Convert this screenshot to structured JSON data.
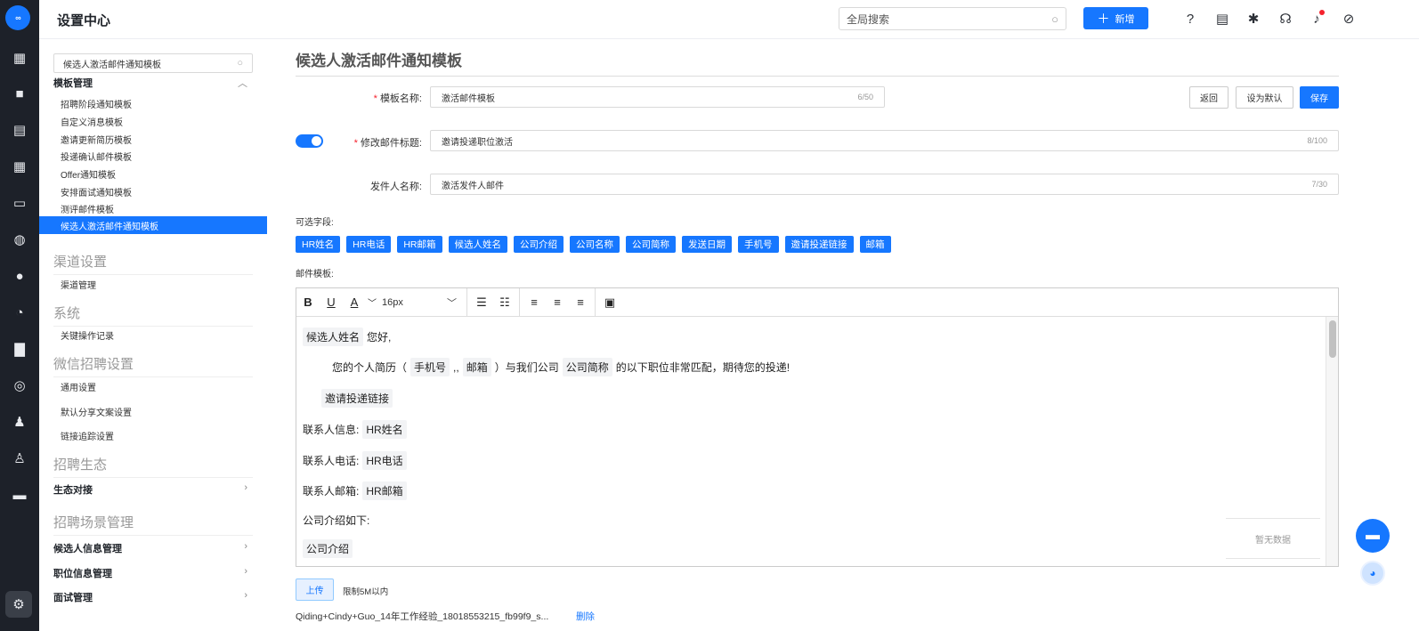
{
  "app": {
    "logo_text": "∞",
    "title": "设置中心"
  },
  "topbar": {
    "search_placeholder": "全局搜索",
    "add_label": "新增",
    "icons": [
      "help-icon",
      "doc-icon",
      "plugin-icon",
      "support-icon",
      "bell-icon",
      "link-icon"
    ]
  },
  "rail": {
    "icons": [
      "dashboard-icon",
      "briefcase-icon",
      "resume-icon",
      "calendar-icon",
      "idcard-icon",
      "wechat-icon",
      "like-icon",
      "pie-chart-icon",
      "bar-chart-icon",
      "compass-icon",
      "users-icon",
      "user-add-icon",
      "message-icon",
      "settings-icon"
    ]
  },
  "sidebar": {
    "search_value": "候选人激活邮件通知模板",
    "template_group": "模板管理",
    "template_items": [
      "招聘阶段通知模板",
      "自定义消息模板",
      "邀请更新简历模板",
      "投递确认邮件模板",
      "Offer通知模板",
      "安排面试通知模板",
      "测评邮件模板",
      "候选人激活邮件通知模板"
    ],
    "sections": [
      {
        "title": "渠道设置",
        "items": [
          "渠道管理"
        ]
      },
      {
        "title": "系统",
        "items": [
          "关键操作记录"
        ]
      },
      {
        "title": "微信招聘设置",
        "items": [
          "通用设置",
          "默认分享文案设置",
          "链接追踪设置"
        ]
      },
      {
        "title": "招聘生态",
        "groups": [
          "生态对接"
        ]
      },
      {
        "title": "招聘场景管理",
        "groups": [
          "候选人信息管理",
          "职位信息管理",
          "面试管理"
        ]
      }
    ]
  },
  "page": {
    "title": "候选人激活邮件通知模板",
    "name_label": "模板名称:",
    "name_value": "激活邮件模板",
    "name_count": "6/50",
    "subject_label": "修改邮件标题:",
    "subject_value": "邀请投递职位激活",
    "subject_count": "8/100",
    "subject_toggle": "on",
    "sender_label": "发件人名称:",
    "sender_value": "激活发件人邮件",
    "sender_count": "7/30",
    "back": "返回",
    "set_default": "设为默认",
    "save": "保存",
    "fields_label": "可选字段:",
    "fields": [
      "HR姓名",
      "HR电话",
      "HR邮箱",
      "候选人姓名",
      "公司介绍",
      "公司名称",
      "公司简称",
      "发送日期",
      "手机号",
      "邀请投递链接",
      "邮箱"
    ],
    "template_label": "邮件模板:",
    "font_size": "16px",
    "editor": {
      "l1_chip": "候选人姓名",
      "l1_text": "您好,",
      "l2_a": "您的个人简历（",
      "l2_chip1": "手机号",
      "l2_b": ",,",
      "l2_chip2": "邮箱",
      "l2_c": "）与我们公司",
      "l2_chip3": "公司简称",
      "l2_d": "的以下职位非常匹配，期待您的投递!",
      "l3_chip": "邀请投递链接",
      "l4_text": "联系人信息:",
      "l4_chip": "HR姓名",
      "l5_text": "联系人电话:",
      "l5_chip": "HR电话",
      "l6_text": "联系人邮箱:",
      "l6_chip": "HR邮箱",
      "l7_text": "公司介绍如下:",
      "l8_chip": "公司介绍"
    },
    "no_data": "暂无数据",
    "upload": "上传",
    "upload_limit": "限制5M以内",
    "file_name": "Qiding+Cindy+Guo_14年工作经验_18018553215_fb99f9_s...",
    "delete": "删除"
  }
}
